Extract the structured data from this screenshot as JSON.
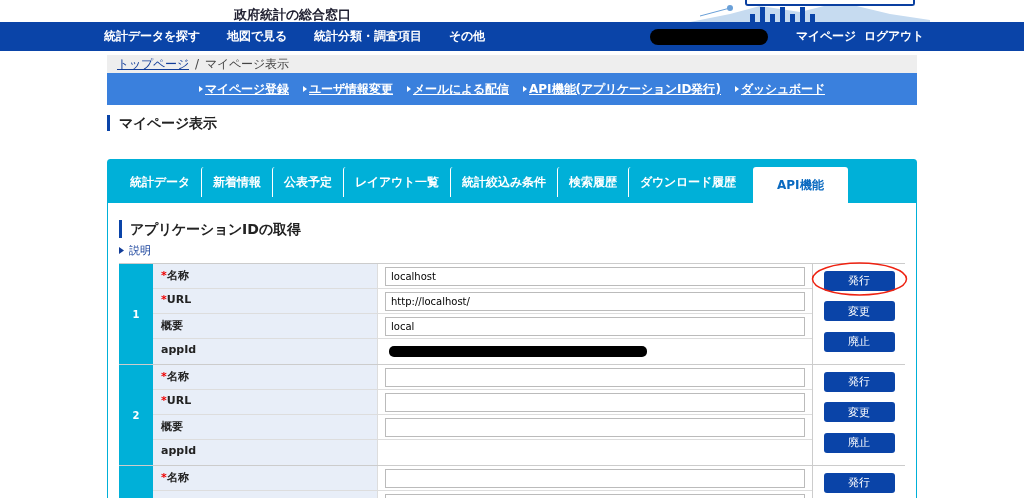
{
  "header": {
    "site_title": "政府統計の総合窓口"
  },
  "nav": {
    "items": [
      "統計データを探す",
      "地図で見る",
      "統計分類・調査項目",
      "その他"
    ],
    "user_redacted": true,
    "right_items": [
      "マイページ",
      "ログアウト"
    ]
  },
  "breadcrumb_separator": "/",
  "breadcrumb": [
    {
      "label": "トップページ",
      "link": true
    },
    {
      "label": "マイページ表示",
      "link": false
    }
  ],
  "sub_links": [
    "マイページ登録",
    "ユーザ情報変更",
    "メールによる配信",
    "API機能(アプリケーションID発行)",
    "ダッシュボード"
  ],
  "page_title": "マイページ表示",
  "tabs": [
    {
      "label": "統計データ",
      "selected": false
    },
    {
      "label": "新着情報",
      "selected": false
    },
    {
      "label": "公表予定",
      "selected": false
    },
    {
      "label": "レイアウト一覧",
      "selected": false
    },
    {
      "label": "統計絞込み条件",
      "selected": false
    },
    {
      "label": "検索履歴",
      "selected": false
    },
    {
      "label": "ダウンロード履歴",
      "selected": false
    },
    {
      "label": "API機能",
      "selected": true
    }
  ],
  "section_title": "アプリケーションIDの取得",
  "help_link": "説明",
  "records": [
    {
      "number": "1",
      "fields": [
        {
          "kind": "input",
          "label": "名称",
          "required_mark": "*",
          "value": "localhost"
        },
        {
          "kind": "input",
          "label": "URL",
          "required_mark": "*",
          "value": "http://localhost/"
        },
        {
          "kind": "input",
          "label": "概要",
          "value": "local"
        },
        {
          "kind": "static",
          "label": "appId",
          "redacted": true
        }
      ],
      "buttons": [
        {
          "label": "発行",
          "circled": true
        },
        {
          "label": "変更",
          "circled": false
        },
        {
          "label": "廃止",
          "circled": false
        }
      ]
    },
    {
      "number": "2",
      "fields": [
        {
          "kind": "input",
          "label": "名称",
          "required_mark": "*"
        },
        {
          "kind": "input",
          "label": "URL",
          "required_mark": "*"
        },
        {
          "kind": "input",
          "label": "概要"
        },
        {
          "kind": "static",
          "label": "appId",
          "redacted": false
        }
      ],
      "buttons": [
        {
          "label": "発行",
          "circled": false
        },
        {
          "label": "変更",
          "circled": false
        },
        {
          "label": "廃止",
          "circled": false
        }
      ]
    },
    {
      "fields": [
        {
          "kind": "input",
          "label": "名称",
          "required_mark": "*"
        },
        {
          "kind": "input"
        }
      ],
      "buttons": [
        {
          "label": "発行",
          "circled": false
        }
      ]
    }
  ]
}
